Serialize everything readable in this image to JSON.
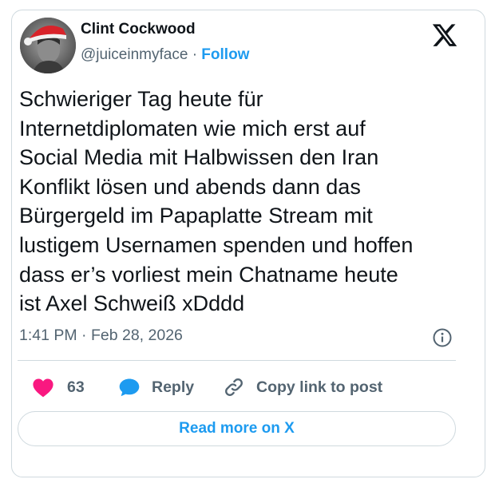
{
  "author": {
    "name": "Clint Cockwood",
    "handle": "@juiceinmyface",
    "separator": "·",
    "follow_label": "Follow"
  },
  "tweet": {
    "text": "Schwieriger Tag heute für\nInternetdiplomaten wie mich erst auf\nSocial Media mit Halbwissen den Iran\nKonflikt lösen und abends dann das\nBürgergeld im Papaplatte Stream mit\nlustigem Usernamen spenden und hoffen\ndass er’s vorliest mein Chatname heute\nist Axel Schweiß xDddd",
    "time": "1:41 PM",
    "separator": "·",
    "date": "Feb 28, 2026"
  },
  "actions": {
    "like_count": "63",
    "reply_label": "Reply",
    "copy_label": "Copy link to post"
  },
  "read_more_label": "Read more on X",
  "icons": {
    "brand": "x-logo-icon",
    "info": "info-icon",
    "like": "heart-icon",
    "reply": "speech-bubble-icon",
    "copy": "link-icon"
  },
  "colors": {
    "accent": "#1d9bf0",
    "heart": "#f91880",
    "text": "#0f1419",
    "secondary": "#536471",
    "border": "#cfd9de"
  }
}
